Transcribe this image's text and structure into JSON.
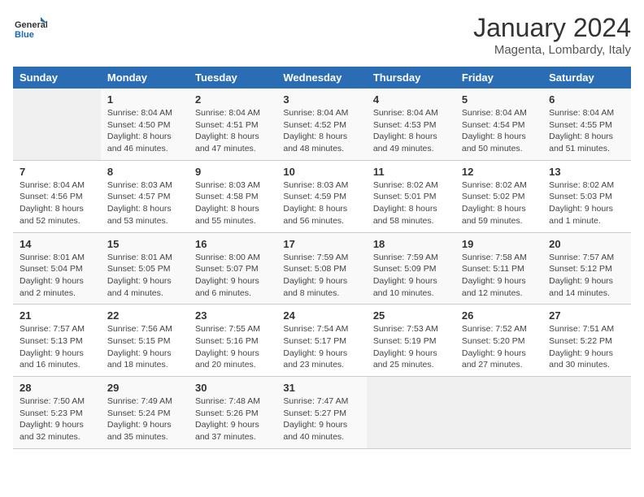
{
  "logo": {
    "text_general": "General",
    "text_blue": "Blue"
  },
  "title": "January 2024",
  "subtitle": "Magenta, Lombardy, Italy",
  "days_of_week": [
    "Sunday",
    "Monday",
    "Tuesday",
    "Wednesday",
    "Thursday",
    "Friday",
    "Saturday"
  ],
  "weeks": [
    [
      {
        "day": "",
        "info": ""
      },
      {
        "day": "1",
        "info": "Sunrise: 8:04 AM\nSunset: 4:50 PM\nDaylight: 8 hours\nand 46 minutes."
      },
      {
        "day": "2",
        "info": "Sunrise: 8:04 AM\nSunset: 4:51 PM\nDaylight: 8 hours\nand 47 minutes."
      },
      {
        "day": "3",
        "info": "Sunrise: 8:04 AM\nSunset: 4:52 PM\nDaylight: 8 hours\nand 48 minutes."
      },
      {
        "day": "4",
        "info": "Sunrise: 8:04 AM\nSunset: 4:53 PM\nDaylight: 8 hours\nand 49 minutes."
      },
      {
        "day": "5",
        "info": "Sunrise: 8:04 AM\nSunset: 4:54 PM\nDaylight: 8 hours\nand 50 minutes."
      },
      {
        "day": "6",
        "info": "Sunrise: 8:04 AM\nSunset: 4:55 PM\nDaylight: 8 hours\nand 51 minutes."
      }
    ],
    [
      {
        "day": "7",
        "info": "Sunrise: 8:04 AM\nSunset: 4:56 PM\nDaylight: 8 hours\nand 52 minutes."
      },
      {
        "day": "8",
        "info": "Sunrise: 8:03 AM\nSunset: 4:57 PM\nDaylight: 8 hours\nand 53 minutes."
      },
      {
        "day": "9",
        "info": "Sunrise: 8:03 AM\nSunset: 4:58 PM\nDaylight: 8 hours\nand 55 minutes."
      },
      {
        "day": "10",
        "info": "Sunrise: 8:03 AM\nSunset: 4:59 PM\nDaylight: 8 hours\nand 56 minutes."
      },
      {
        "day": "11",
        "info": "Sunrise: 8:02 AM\nSunset: 5:01 PM\nDaylight: 8 hours\nand 58 minutes."
      },
      {
        "day": "12",
        "info": "Sunrise: 8:02 AM\nSunset: 5:02 PM\nDaylight: 8 hours\nand 59 minutes."
      },
      {
        "day": "13",
        "info": "Sunrise: 8:02 AM\nSunset: 5:03 PM\nDaylight: 9 hours\nand 1 minute."
      }
    ],
    [
      {
        "day": "14",
        "info": "Sunrise: 8:01 AM\nSunset: 5:04 PM\nDaylight: 9 hours\nand 2 minutes."
      },
      {
        "day": "15",
        "info": "Sunrise: 8:01 AM\nSunset: 5:05 PM\nDaylight: 9 hours\nand 4 minutes."
      },
      {
        "day": "16",
        "info": "Sunrise: 8:00 AM\nSunset: 5:07 PM\nDaylight: 9 hours\nand 6 minutes."
      },
      {
        "day": "17",
        "info": "Sunrise: 7:59 AM\nSunset: 5:08 PM\nDaylight: 9 hours\nand 8 minutes."
      },
      {
        "day": "18",
        "info": "Sunrise: 7:59 AM\nSunset: 5:09 PM\nDaylight: 9 hours\nand 10 minutes."
      },
      {
        "day": "19",
        "info": "Sunrise: 7:58 AM\nSunset: 5:11 PM\nDaylight: 9 hours\nand 12 minutes."
      },
      {
        "day": "20",
        "info": "Sunrise: 7:57 AM\nSunset: 5:12 PM\nDaylight: 9 hours\nand 14 minutes."
      }
    ],
    [
      {
        "day": "21",
        "info": "Sunrise: 7:57 AM\nSunset: 5:13 PM\nDaylight: 9 hours\nand 16 minutes."
      },
      {
        "day": "22",
        "info": "Sunrise: 7:56 AM\nSunset: 5:15 PM\nDaylight: 9 hours\nand 18 minutes."
      },
      {
        "day": "23",
        "info": "Sunrise: 7:55 AM\nSunset: 5:16 PM\nDaylight: 9 hours\nand 20 minutes."
      },
      {
        "day": "24",
        "info": "Sunrise: 7:54 AM\nSunset: 5:17 PM\nDaylight: 9 hours\nand 23 minutes."
      },
      {
        "day": "25",
        "info": "Sunrise: 7:53 AM\nSunset: 5:19 PM\nDaylight: 9 hours\nand 25 minutes."
      },
      {
        "day": "26",
        "info": "Sunrise: 7:52 AM\nSunset: 5:20 PM\nDaylight: 9 hours\nand 27 minutes."
      },
      {
        "day": "27",
        "info": "Sunrise: 7:51 AM\nSunset: 5:22 PM\nDaylight: 9 hours\nand 30 minutes."
      }
    ],
    [
      {
        "day": "28",
        "info": "Sunrise: 7:50 AM\nSunset: 5:23 PM\nDaylight: 9 hours\nand 32 minutes."
      },
      {
        "day": "29",
        "info": "Sunrise: 7:49 AM\nSunset: 5:24 PM\nDaylight: 9 hours\nand 35 minutes."
      },
      {
        "day": "30",
        "info": "Sunrise: 7:48 AM\nSunset: 5:26 PM\nDaylight: 9 hours\nand 37 minutes."
      },
      {
        "day": "31",
        "info": "Sunrise: 7:47 AM\nSunset: 5:27 PM\nDaylight: 9 hours\nand 40 minutes."
      },
      {
        "day": "",
        "info": ""
      },
      {
        "day": "",
        "info": ""
      },
      {
        "day": "",
        "info": ""
      }
    ]
  ]
}
